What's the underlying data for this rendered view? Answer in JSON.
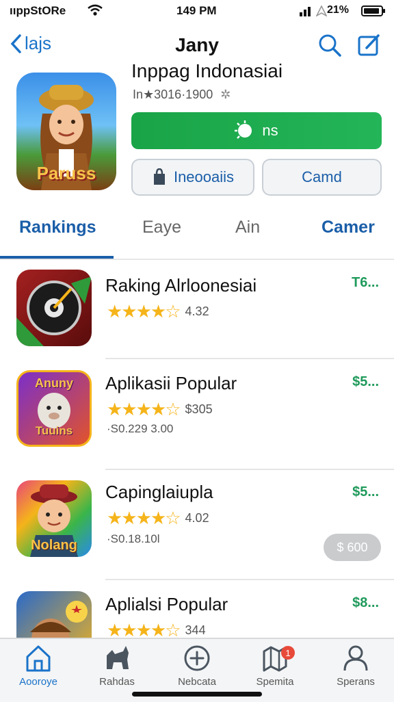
{
  "status_bar": {
    "carrier": "ııppStORe",
    "time": "149 PM",
    "battery": "21%"
  },
  "nav": {
    "back_label": "lajs",
    "title": "Jany"
  },
  "hero": {
    "title": "Inppag Indonasiai",
    "subtitle": "In★3016·1900",
    "get_label": "ns",
    "secondary_left": "Ineooaiis",
    "secondary_right": "Camd",
    "icon_text": "Paruss"
  },
  "tabs": [
    {
      "label": "Rankings",
      "active": true
    },
    {
      "label": "Eaye",
      "active": false
    },
    {
      "label": "Ain",
      "active": false
    },
    {
      "label": "Camer",
      "active": false
    }
  ],
  "list": [
    {
      "title": "Raking Alrloonesiai",
      "rating": "4.32",
      "stars": 4.5,
      "subtitle": "",
      "price": "T6...",
      "icon": "dial-icon"
    },
    {
      "title": "Aplikasii Popular",
      "rating": "$305",
      "stars": 4.5,
      "subtitle": "·S0.229 3.00",
      "price": "$5...",
      "icon": "llama-game-icon",
      "icon_text_top": "Anuny",
      "icon_text_bottom": "Tuuins"
    },
    {
      "title": "Capinglaiupla",
      "rating": "4.02",
      "stars": 3.5,
      "subtitle": "·S0.18.10l",
      "price": "$5...",
      "icon": "boy-hat-icon",
      "icon_text_bottom": "Nolang",
      "pill": "$ 600"
    },
    {
      "title": "Aplialsi Popular",
      "rating": "344",
      "stars": 4.5,
      "subtitle": "",
      "price": "$8...",
      "icon": "girl-star-icon"
    }
  ],
  "tabbar": [
    {
      "label": "Aooroye",
      "icon": "home-icon",
      "active": true
    },
    {
      "label": "Rahdas",
      "icon": "dog-icon",
      "active": false
    },
    {
      "label": "Nebcata",
      "icon": "plus-circle-icon",
      "active": false
    },
    {
      "label": "Spemita",
      "icon": "map-icon",
      "active": false,
      "badge": "1"
    },
    {
      "label": "Sperans",
      "icon": "person-icon",
      "active": false
    }
  ],
  "colors": {
    "accent": "#1a73c9",
    "green": "#1fa44a",
    "star": "#f5b41a",
    "price": "#1f9a5b"
  }
}
